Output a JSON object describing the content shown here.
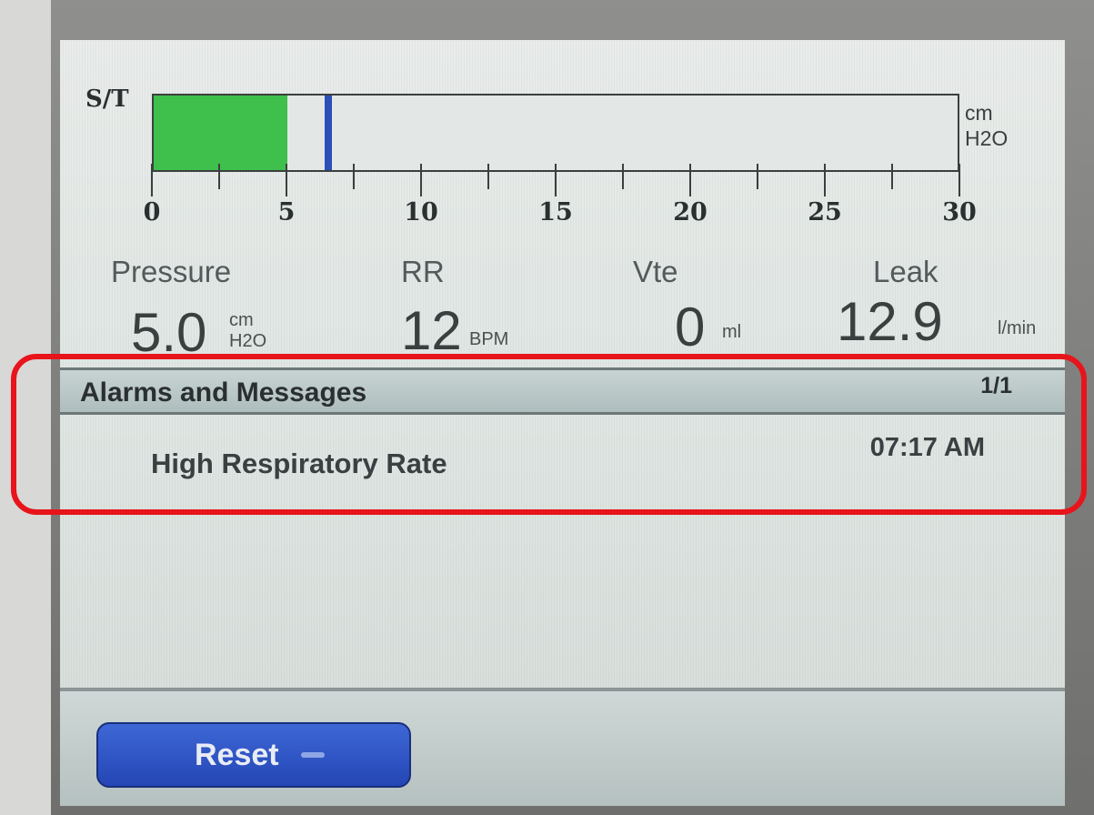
{
  "mode": "S/T",
  "gauge": {
    "unit_line1": "cm",
    "unit_line2": "H2O",
    "scale_min": 0,
    "scale_max": 30,
    "fill_value": 5.0,
    "marker_value": 6.5,
    "fill_color": "#3fbf4b",
    "marker_color": "#2c4fb8",
    "tick_labels": [
      "0",
      "5",
      "10",
      "15",
      "20",
      "25",
      "30"
    ]
  },
  "metrics": {
    "pressure": {
      "label": "Pressure",
      "value": "5.0",
      "unit_top": "cm",
      "unit_bottom": "H2O"
    },
    "rr": {
      "label": "RR",
      "value": "12",
      "unit": "BPM"
    },
    "vte": {
      "label": "Vte",
      "value": "0",
      "unit": "ml"
    },
    "leak": {
      "label": "Leak",
      "value": "12.9",
      "unit": "l/min"
    }
  },
  "alarms": {
    "title": "Alarms and Messages",
    "page": "1/1",
    "items": [
      {
        "message": "High Respiratory Rate",
        "time": "07:17 AM"
      }
    ]
  },
  "footer": {
    "reset_label": "Reset"
  },
  "colors": {
    "highlight": "#e8141b",
    "button": "#2c4fb8"
  }
}
